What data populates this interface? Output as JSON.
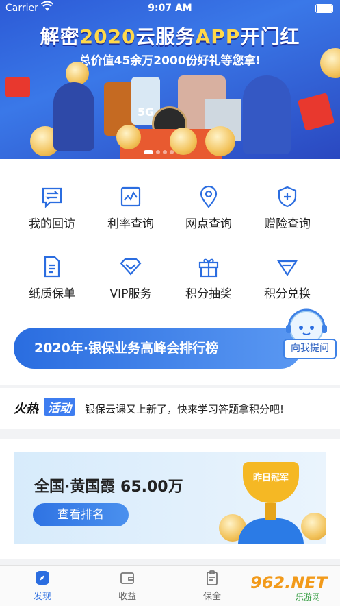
{
  "status": {
    "carrier": "Carrier",
    "time": "9:07 AM"
  },
  "banner": {
    "title_a": "解密",
    "title_b": "2020",
    "title_c": "云服务",
    "title_d": "APP",
    "title_e": "开门红",
    "subtitle": "总价值45余万2000份好礼等您拿!",
    "phone_badge": "5G"
  },
  "grid": {
    "items": [
      {
        "label": "我的回访",
        "icon": "swap-chat-icon"
      },
      {
        "label": "利率查询",
        "icon": "chart-icon"
      },
      {
        "label": "网点查询",
        "icon": "location-pin-icon"
      },
      {
        "label": "赠险查询",
        "icon": "shield-plus-icon"
      },
      {
        "label": "纸质保单",
        "icon": "document-icon"
      },
      {
        "label": "VIP服务",
        "icon": "diamond-icon"
      },
      {
        "label": "积分抽奖",
        "icon": "gift-icon"
      },
      {
        "label": "积分兑换",
        "icon": "gem-icon"
      }
    ]
  },
  "rank_banner": {
    "text": "2020年·银保业务高峰会排行榜",
    "ask_button": "向我提问"
  },
  "notice": {
    "tag_a": "火热",
    "tag_b": "活动",
    "text": "银保云课又上新了，快来学习答题拿积分吧!"
  },
  "card": {
    "name": "全国·黄国霞 65.00万",
    "button": "查看排名",
    "trophy_label": "昨日冠军"
  },
  "tabbar": {
    "tabs": [
      {
        "label": "发现",
        "icon": "compass-icon",
        "active": true
      },
      {
        "label": "收益",
        "icon": "wallet-icon",
        "active": false
      },
      {
        "label": "保全",
        "icon": "clipboard-icon",
        "active": false
      },
      {
        "label": "",
        "icon": "user-icon",
        "active": false
      }
    ]
  },
  "watermark": {
    "brand": "962.NET",
    "site": "乐游网"
  },
  "colors": {
    "primary": "#2b6de0",
    "banner_bg": "#3a78e8",
    "gold": "#f5b824"
  }
}
